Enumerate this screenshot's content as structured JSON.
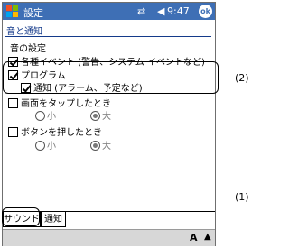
{
  "titlebar": {
    "app_title": "設定",
    "time": "9:47",
    "ok_label": "ok"
  },
  "page": {
    "header": "音と通知",
    "section_label": "音の設定"
  },
  "options": {
    "events": "各種イベント (警告、システム イベントなど)",
    "programs": "プログラム",
    "notifications": "通知 (アラーム、予定など)",
    "tap_screen": "画面をタップしたとき",
    "tap_small": "小",
    "tap_large": "大",
    "press_button": "ボタンを押したとき",
    "button_small": "小",
    "button_large": "大"
  },
  "tabs": [
    "サウンド",
    "通知"
  ],
  "callouts": {
    "label1": "(1)",
    "label2": "(2)"
  },
  "bottombar": {
    "keyboard_label": "A"
  }
}
